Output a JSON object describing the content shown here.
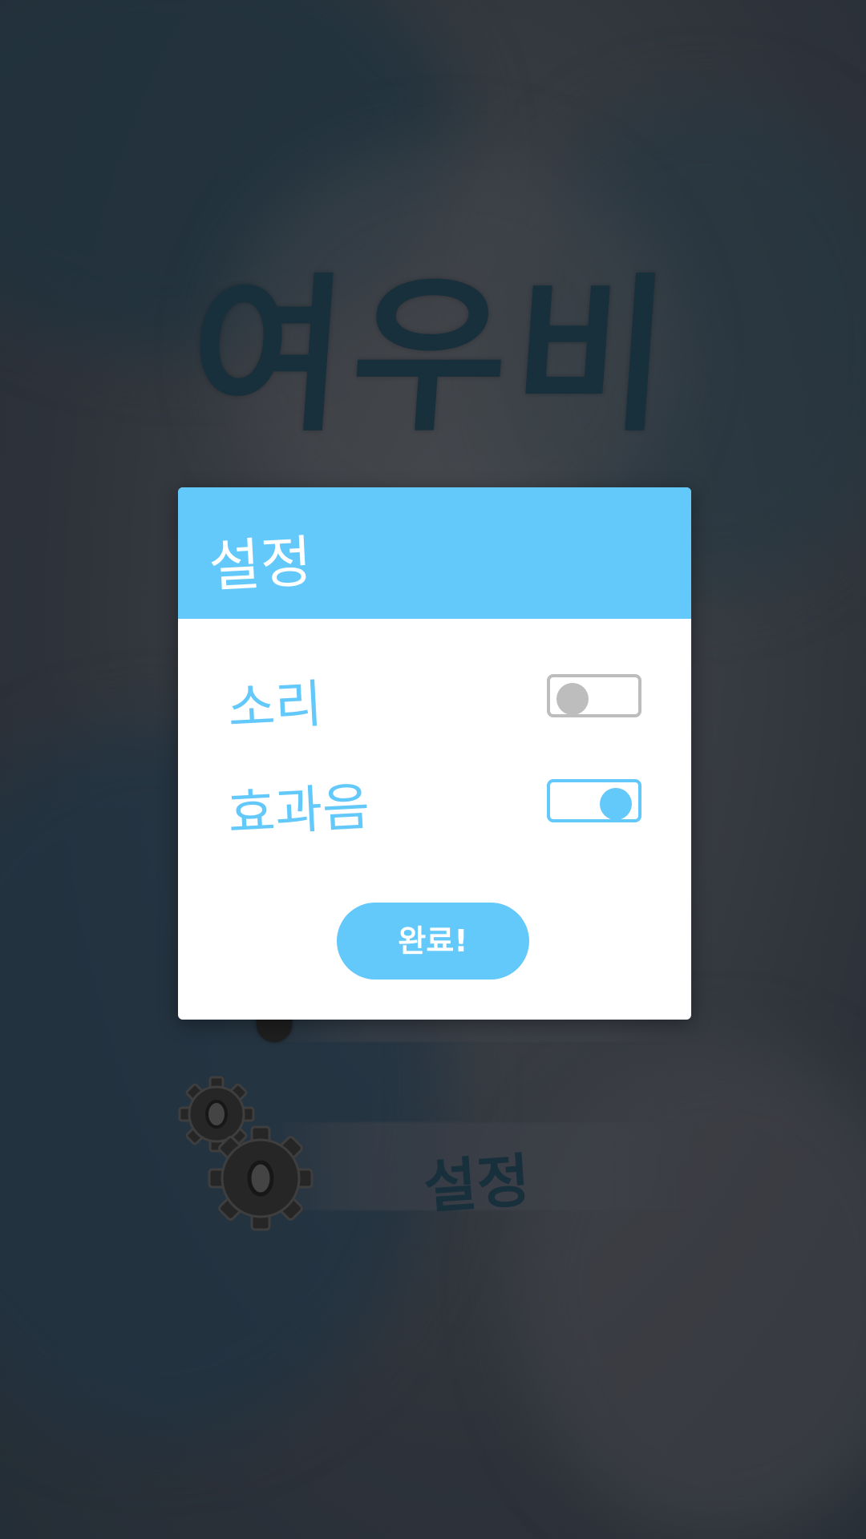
{
  "background": {
    "game_title": "여우비",
    "menu": {
      "settings_label": "설정"
    }
  },
  "dialog": {
    "title": "설정",
    "settings": [
      {
        "label": "소리",
        "enabled": false
      },
      {
        "label": "효과음",
        "enabled": true
      }
    ],
    "done_label": "완료!"
  },
  "colors": {
    "accent": "#63c8fa",
    "toggle_off": "#bdbdbd",
    "dialog_bg": "#ffffff",
    "title_dark": "#1b3442"
  },
  "icons": [
    "gear-icon"
  ]
}
